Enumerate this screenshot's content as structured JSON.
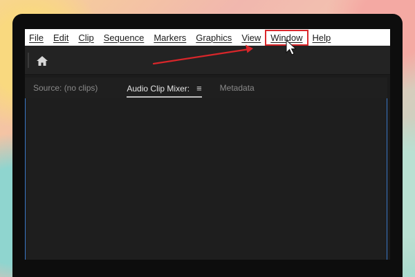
{
  "menu": {
    "items": [
      {
        "label": "File"
      },
      {
        "label": "Edit"
      },
      {
        "label": "Clip"
      },
      {
        "label": "Sequence"
      },
      {
        "label": "Markers"
      },
      {
        "label": "Graphics"
      },
      {
        "label": "View"
      },
      {
        "label": "Window",
        "highlighted": true
      },
      {
        "label": "Help"
      }
    ]
  },
  "toolbar": {
    "home_icon": "home-icon"
  },
  "panel": {
    "tabs": [
      {
        "label": "Source: (no clips)",
        "active": false
      },
      {
        "label": "Audio Clip Mixer:",
        "active": true
      },
      {
        "label": "Metadata",
        "active": false
      }
    ],
    "tab_menu_glyph": "≡"
  },
  "annotation": {
    "color": "#d9262a",
    "arrow_icon": "red-arrow-icon",
    "cursor_icon": "mouse-cursor-icon"
  }
}
